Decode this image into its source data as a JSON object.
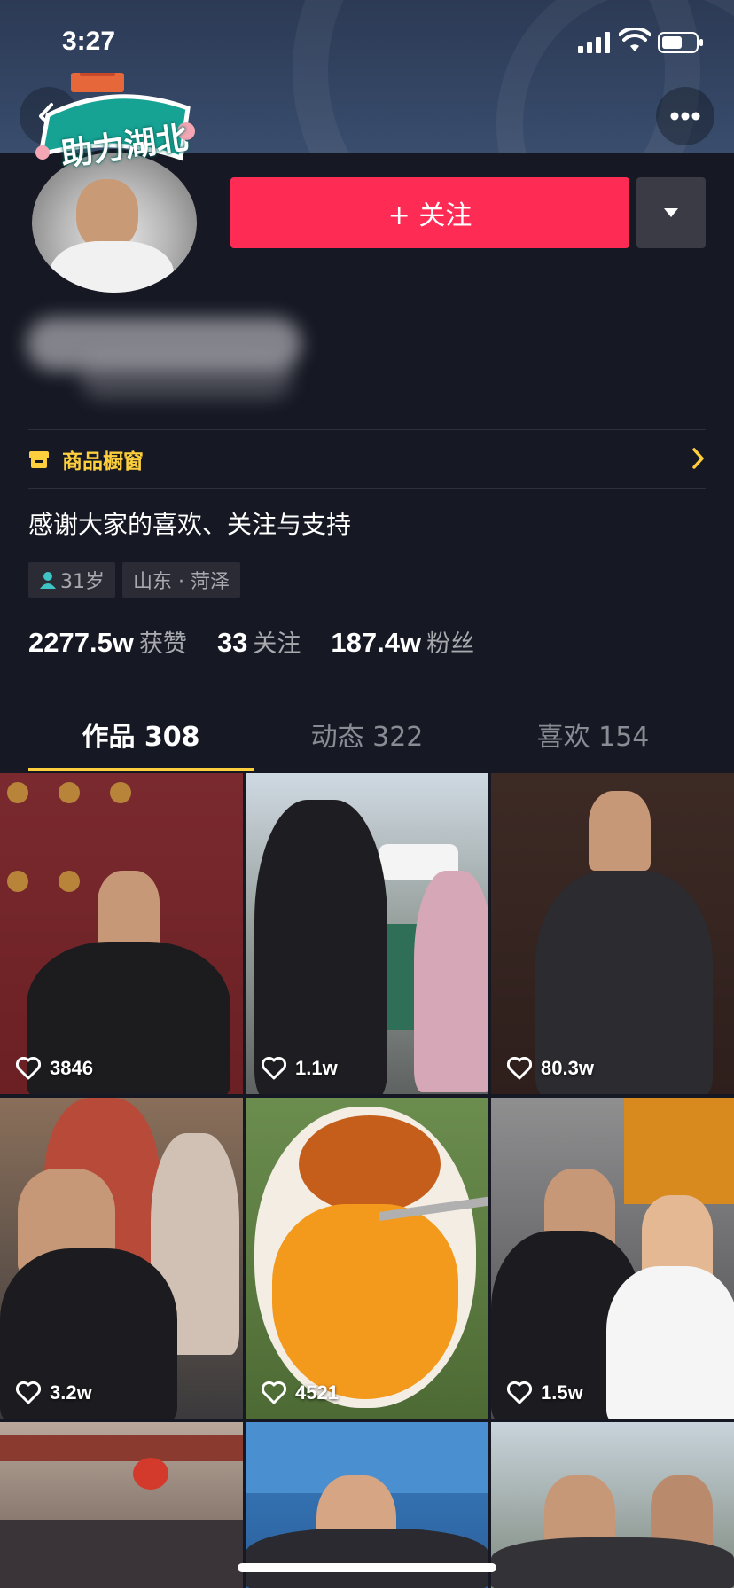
{
  "status_bar": {
    "time": "3:27"
  },
  "header": {
    "badge_text": "助力湖北",
    "follow_label": "+ 关注"
  },
  "shop": {
    "label": "商品橱窗"
  },
  "profile": {
    "signature": "感谢大家的喜欢、关注与支持",
    "age": "31岁",
    "location": "山东 · 菏泽"
  },
  "stats": {
    "likes_num": "2277.5w",
    "likes_label": "获赞",
    "following_num": "33",
    "following_label": "关注",
    "followers_num": "187.4w",
    "followers_label": "粉丝"
  },
  "tabs": [
    {
      "label": "作品 308"
    },
    {
      "label": "动态 322"
    },
    {
      "label": "喜欢 154"
    }
  ],
  "videos": [
    {
      "likes": "3846"
    },
    {
      "likes": "1.1w"
    },
    {
      "likes": "80.3w"
    },
    {
      "likes": "3.2w"
    },
    {
      "likes": "4521"
    },
    {
      "likes": "1.5w"
    },
    {
      "likes": ""
    },
    {
      "likes": ""
    },
    {
      "likes": ""
    }
  ],
  "colors": {
    "accent": "#fe2c55",
    "background": "#161823",
    "highlight": "#fdcf3d"
  }
}
